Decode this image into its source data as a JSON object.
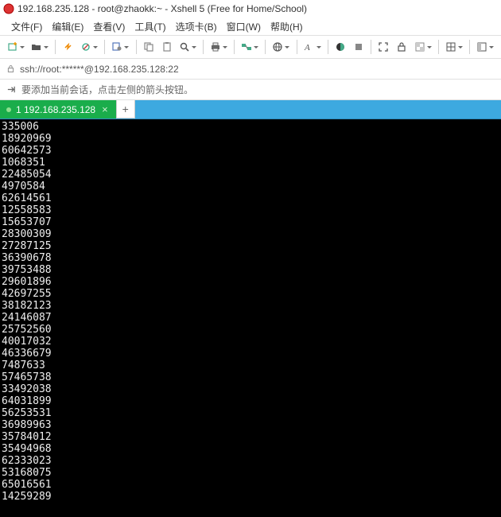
{
  "titlebar": {
    "text": "192.168.235.128 - root@zhaokk:~ - Xshell 5 (Free for Home/School)"
  },
  "menu": {
    "file": "文件(F)",
    "edit": "编辑(E)",
    "view": "查看(V)",
    "tools": "工具(T)",
    "tabs": "选项卡(B)",
    "window": "窗口(W)",
    "help": "帮助(H)"
  },
  "addressbar": {
    "url": "ssh://root:******@192.168.235.128:22"
  },
  "tipbar": {
    "text": "要添加当前会话，点击左侧的箭头按钮。"
  },
  "tabs": {
    "active": {
      "label": "1 192.168.235.128"
    }
  },
  "terminal_lines": [
    "335006",
    "18920969",
    "60642573",
    "1068351",
    "22485054",
    "4970584",
    "62614561",
    "12558583",
    "15653707",
    "28300309",
    "27287125",
    "36390678",
    "39753488",
    "29601896",
    "42697255",
    "38182123",
    "24146087",
    "25752560",
    "40017032",
    "46336679",
    "7487633",
    "57465738",
    "33492038",
    "64031899",
    "56253531",
    "36989963",
    "35784012",
    "35494968",
    "62333023",
    "53168075",
    "65016561",
    "14259289"
  ]
}
